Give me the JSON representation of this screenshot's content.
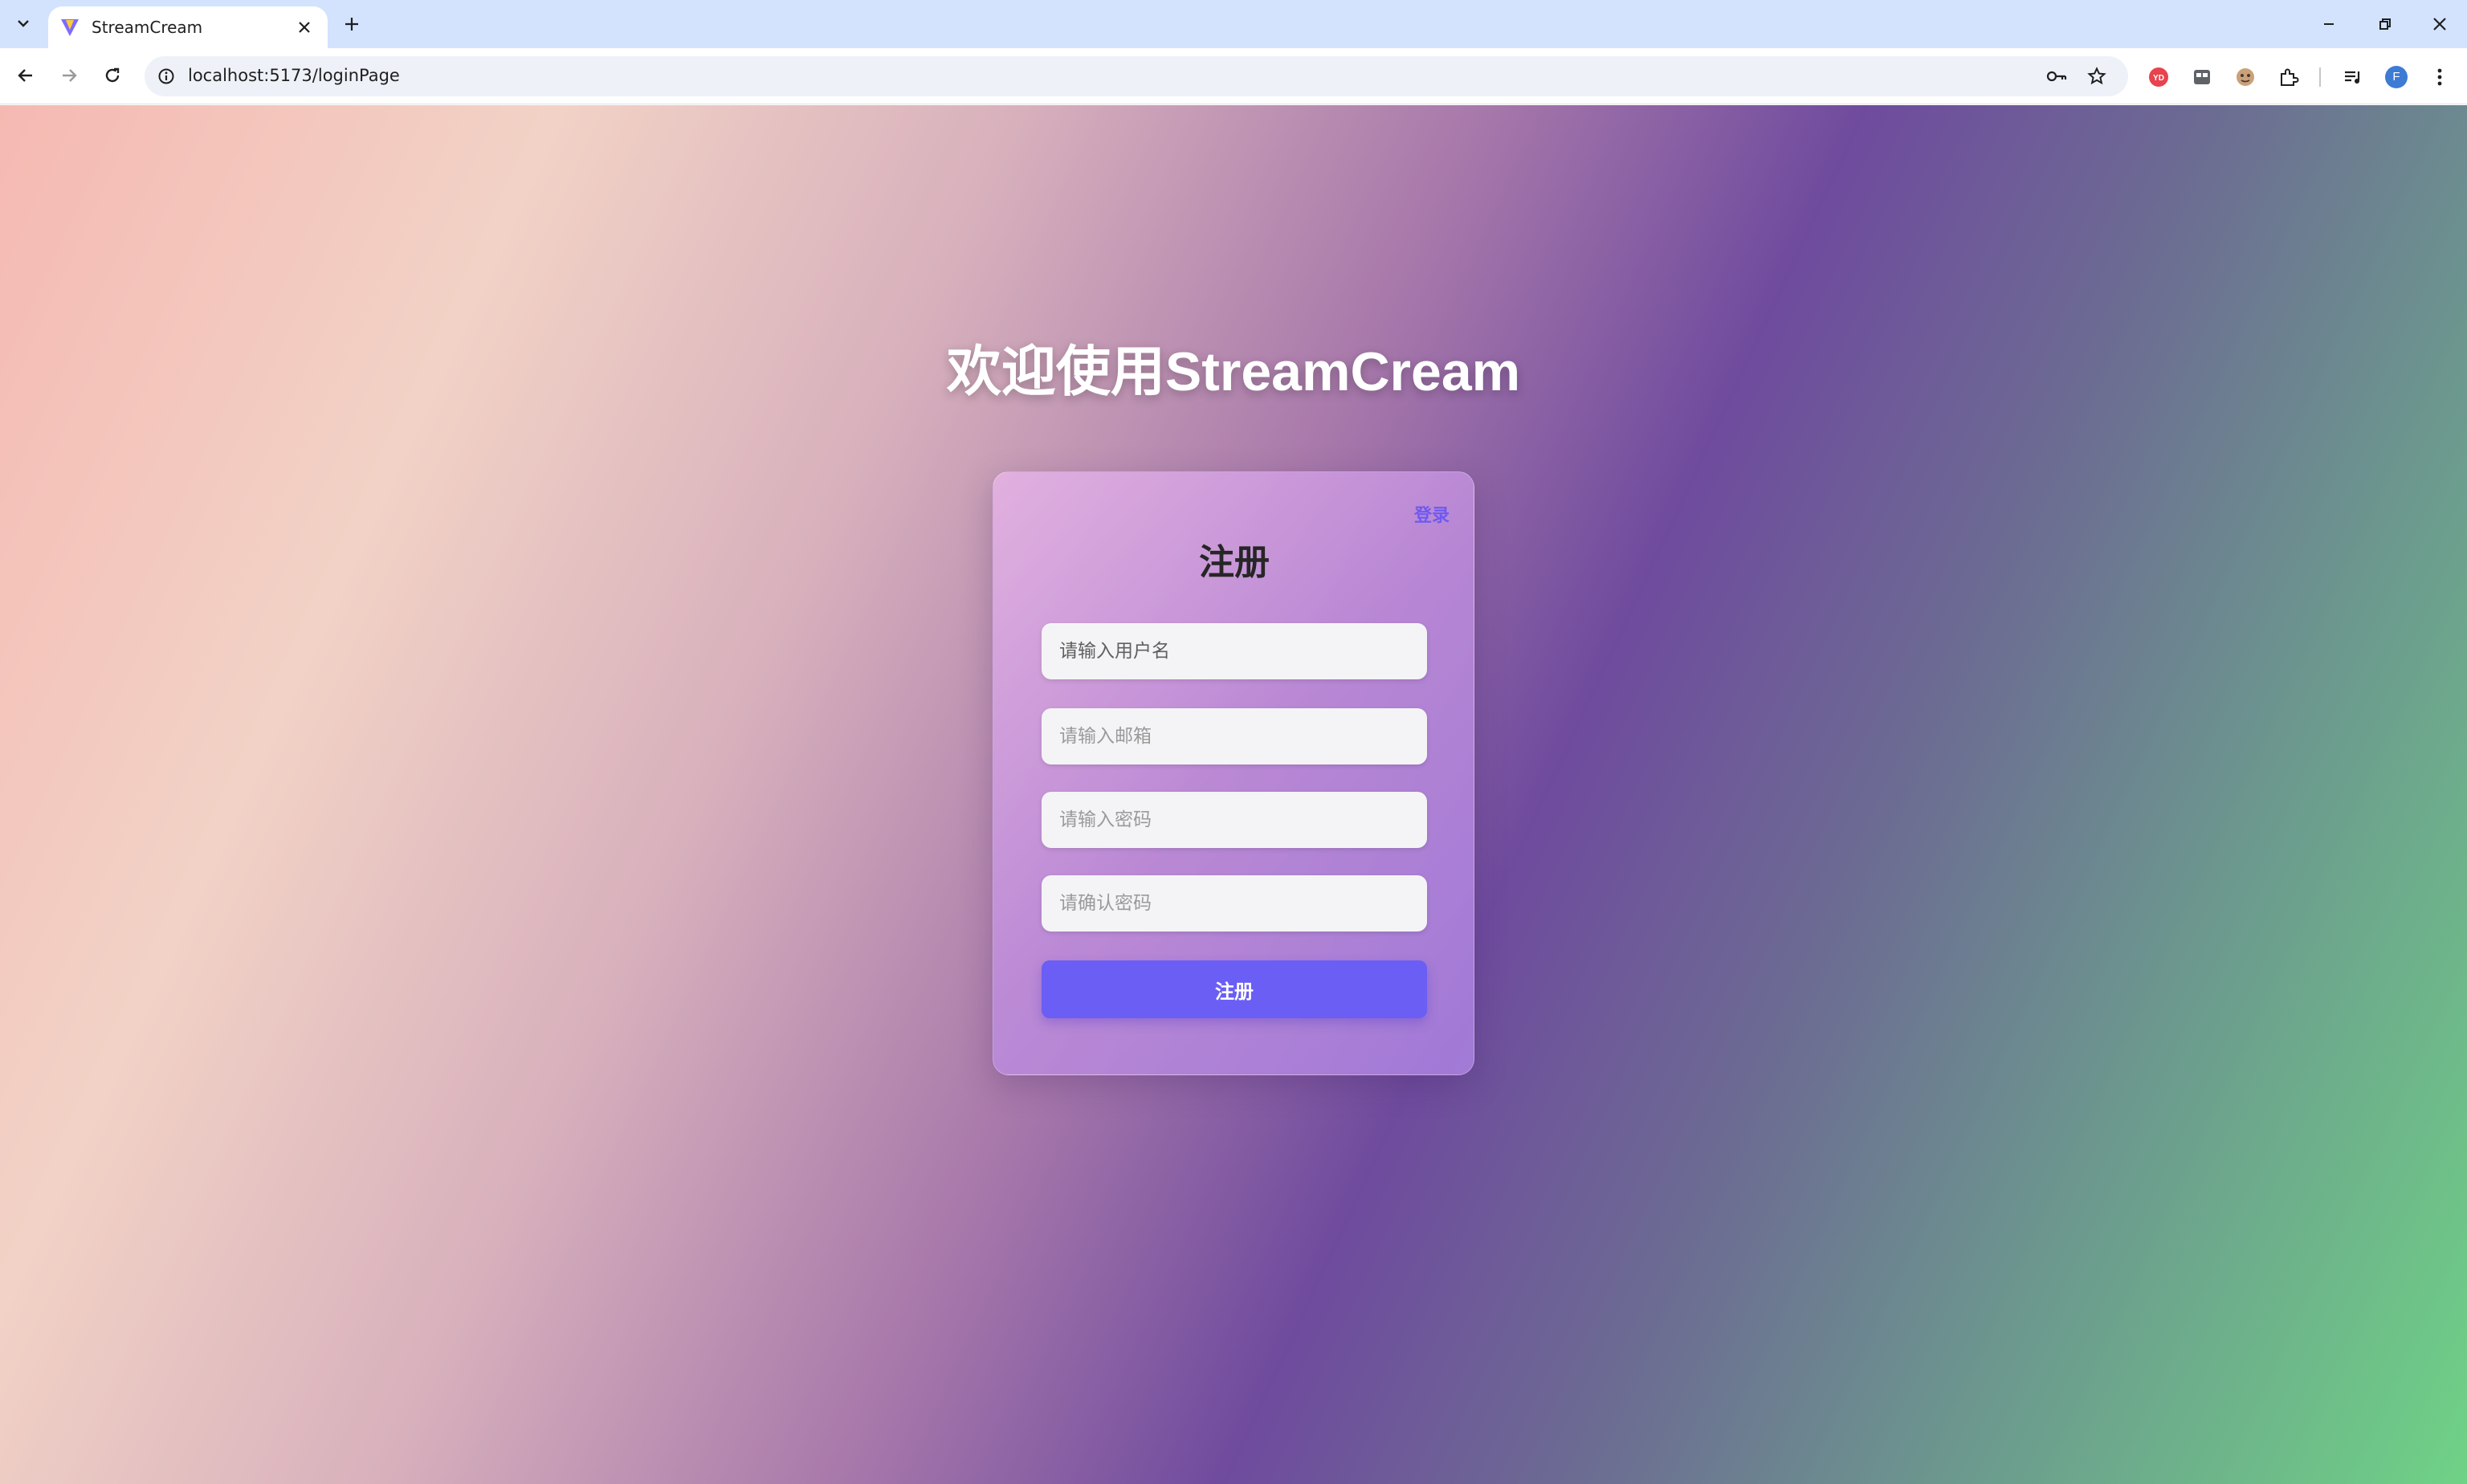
{
  "browser": {
    "tab_title": "StreamCream",
    "url": "localhost:5173/loginPage",
    "profile_initial": "F"
  },
  "page": {
    "headline": "欢迎使用StreamCream",
    "card": {
      "title": "注册",
      "switch_link": "登录",
      "username_placeholder": "请输入用户名",
      "email_placeholder": "请输入邮箱",
      "password_placeholder": "请输入密码",
      "confirm_placeholder": "请确认密码",
      "submit_label": "注册"
    }
  },
  "colors": {
    "accent": "#6a5ef4",
    "link": "#6e5af0",
    "chrome_tabbar": "#d3e3fd"
  },
  "icons": [
    "tab-search-icon",
    "vite-favicon-icon",
    "close-icon",
    "plus-icon",
    "minimize-icon",
    "restore-icon",
    "back-icon",
    "forward-icon",
    "reload-icon",
    "site-info-icon",
    "password-key-icon",
    "bookmark-star-icon",
    "extension-icon",
    "media-control-icon",
    "kebab-menu-icon"
  ]
}
